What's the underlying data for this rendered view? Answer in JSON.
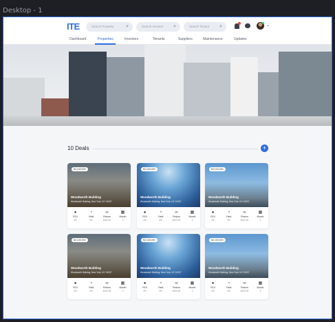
{
  "frame_label": "Desktop - 1",
  "logo": "ITE",
  "search": {
    "property_placeholder": "Search Property",
    "investor_placeholder": "Search Investor",
    "tenant_placeholder": "Search Tenant"
  },
  "nav": [
    "Dashboard",
    "Properties",
    "Investors",
    "Tenants",
    "Suppliers",
    "Maintenance",
    "Updates"
  ],
  "active_nav": "Properties",
  "deals_title": "10 Deals",
  "add_label": "+",
  "cards": [
    {
      "price": "$2,100,000",
      "name": "Woodworth Building",
      "address": "Woodworth Building, New York, NY 10007",
      "image": "skyline-dusk"
    },
    {
      "price": "$2,100,000",
      "name": "Woodworth Building",
      "address": "Woodworth Building, New York, NY 10007",
      "image": "glass-tower"
    },
    {
      "price": "$2,100,000",
      "name": "Woodworth Building",
      "address": "Woodworth Building, New York, NY 10007",
      "image": "skyline-day"
    },
    {
      "price": "$2,100,000",
      "name": "Woodworth Building",
      "address": "Woodworth Building, New York, NY 10007",
      "image": "skyline-dusk"
    },
    {
      "price": "$2,100,000",
      "name": "Woodworth Building",
      "address": "Woodworth Building, New York, NY 10007",
      "image": "glass-tower"
    },
    {
      "price": "$2,100,000",
      "name": "Woodworth Building",
      "address": "Woodworth Building, New York, NY 10007",
      "image": "skyline-day"
    }
  ],
  "stats": [
    {
      "label": "ROI",
      "value": "3%",
      "icon": "money-bag-icon"
    },
    {
      "label": "Yield",
      "value": "3%",
      "icon": "pie-chart-icon"
    },
    {
      "label": "Return",
      "value": "$100.00",
      "icon": "infinity-icon"
    },
    {
      "label": "Month",
      "value": "3",
      "icon": "calendar-icon"
    }
  ],
  "colors": {
    "accent": "#2f6fde",
    "frame_border": "#2f6fde",
    "background": "#f5f6f8"
  }
}
